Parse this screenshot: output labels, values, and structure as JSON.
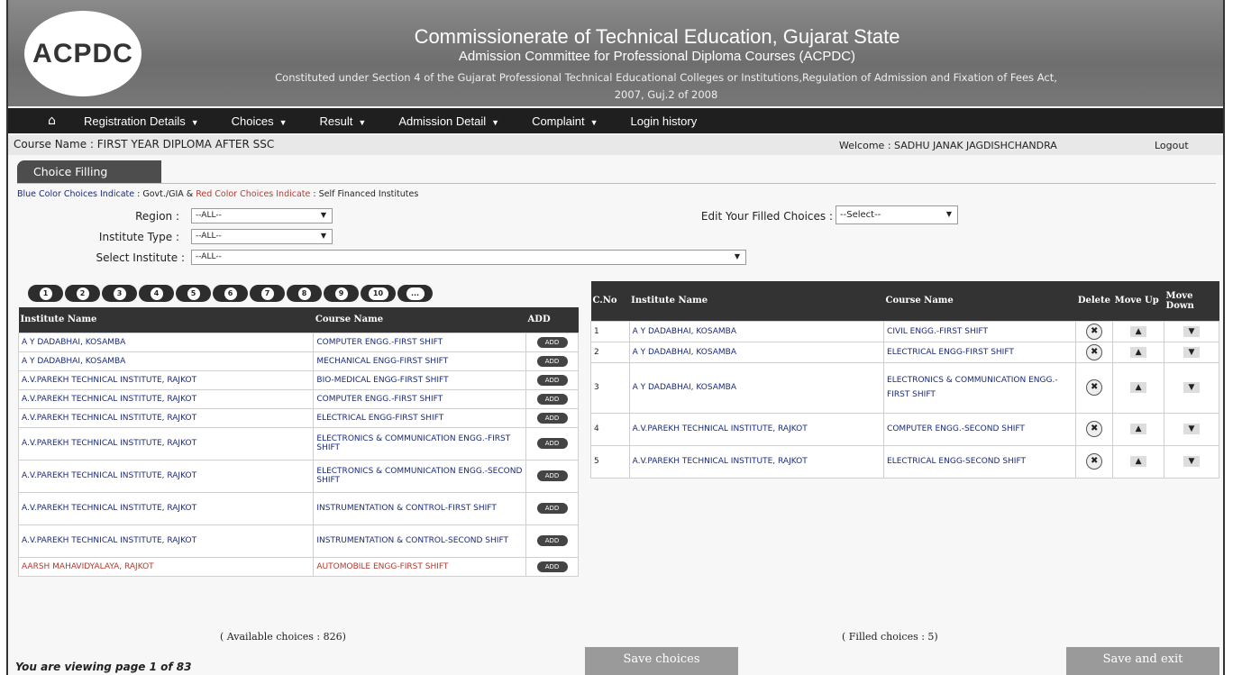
{
  "header": {
    "logo_text": "ACPDC",
    "title": "Commissionerate of Technical Education, Gujarat State",
    "subtitle": "Admission Committee for Professional Diploma Courses (ACPDC)",
    "act_line1": "Constituted under Section 4 of the Gujarat Professional Technical Educational Colleges or Institutions,Regulation of Admission and Fixation of Fees Act,",
    "act_line2": "2007, Guj.2 of 2008"
  },
  "nav": {
    "home_icon": "home-icon",
    "items": [
      "Registration Details",
      "Choices",
      "Result",
      "Admission Detail",
      "Complaint",
      "Login history"
    ]
  },
  "info": {
    "course": "Course Name : FIRST YEAR DIPLOMA AFTER SSC",
    "welcome": "Welcome : SADHU JANAK JAGDISHCHANDRA",
    "logout": "Logout"
  },
  "tab": {
    "label": "Choice Filling"
  },
  "legend": {
    "blue_label": "Blue Color Choices Indicate",
    "blue_value": " : Govt./GIA & ",
    "red_label": "Red Color Choices Indicate",
    "red_value": " : Self Financed Institutes"
  },
  "filters": {
    "region_label": "Region :",
    "region_value": "--ALL--",
    "type_label": "Institute Type :",
    "type_value": "--ALL--",
    "institute_label": "Select Institute :",
    "institute_value": "--ALL--",
    "edit_label": "Edit Your Filled Choices :",
    "edit_value": "--Select--"
  },
  "pager": [
    "1",
    "2",
    "3",
    "4",
    "5",
    "6",
    "7",
    "8",
    "9",
    "10",
    "..."
  ],
  "available": {
    "headers": [
      "Institute Name",
      "Course Name",
      "ADD"
    ],
    "add_label": "ADD",
    "rows": [
      {
        "institute": "A Y DADABHAI, KOSAMBA",
        "course": "COMPUTER ENGG.-FIRST SHIFT"
      },
      {
        "institute": "A Y DADABHAI, KOSAMBA",
        "course": "MECHANICAL ENGG-FIRST SHIFT"
      },
      {
        "institute": "A.V.PAREKH TECHNICAL INSTITUTE, RAJKOT",
        "course": "BIO-MEDICAL ENGG-FIRST SHIFT"
      },
      {
        "institute": "A.V.PAREKH TECHNICAL INSTITUTE, RAJKOT",
        "course": "COMPUTER ENGG.-FIRST SHIFT"
      },
      {
        "institute": "A.V.PAREKH TECHNICAL INSTITUTE, RAJKOT",
        "course": "ELECTRICAL ENGG-FIRST SHIFT"
      },
      {
        "institute": "A.V.PAREKH TECHNICAL INSTITUTE, RAJKOT",
        "course": "ELECTRONICS & COMMUNICATION ENGG.-FIRST SHIFT"
      },
      {
        "institute": "A.V.PAREKH TECHNICAL INSTITUTE, RAJKOT",
        "course": "ELECTRONICS & COMMUNICATION ENGG.-SECOND SHIFT"
      },
      {
        "institute": "A.V.PAREKH TECHNICAL INSTITUTE, RAJKOT",
        "course": "INSTRUMENTATION & CONTROL-FIRST SHIFT"
      },
      {
        "institute": "A.V.PAREKH TECHNICAL INSTITUTE, RAJKOT",
        "course": "INSTRUMENTATION & CONTROL-SECOND SHIFT"
      },
      {
        "institute": "AARSH MAHAVIDYALAYA, RAJKOT",
        "course": "AUTOMOBILE ENGG-FIRST SHIFT"
      }
    ],
    "count_text": "( Available choices : 826)"
  },
  "filled": {
    "headers": [
      "C.No",
      "Institute Name",
      "Course Name",
      "Delete",
      "Move Up",
      "Move Down"
    ],
    "rows": [
      {
        "no": "1",
        "institute": "A Y DADABHAI, KOSAMBA",
        "course": "CIVIL ENGG.-FIRST SHIFT"
      },
      {
        "no": "2",
        "institute": "A Y DADABHAI, KOSAMBA",
        "course": "ELECTRICAL ENGG-FIRST SHIFT"
      },
      {
        "no": "3",
        "institute": "A Y DADABHAI, KOSAMBA",
        "course": "ELECTRONICS & COMMUNICATION ENGG.-FIRST SHIFT"
      },
      {
        "no": "4",
        "institute": "A.V.PAREKH TECHNICAL INSTITUTE, RAJKOT",
        "course": "COMPUTER ENGG.-SECOND SHIFT"
      },
      {
        "no": "5",
        "institute": "A.V.PAREKH TECHNICAL INSTITUTE, RAJKOT",
        "course": "ELECTRICAL ENGG-SECOND SHIFT"
      }
    ],
    "count_text": "( Filled choices : 5)"
  },
  "buttons": {
    "save_choices": "Save choices",
    "save_exit": "Save and exit"
  },
  "footer": {
    "viewing": "You are viewing page 1 of 83"
  }
}
